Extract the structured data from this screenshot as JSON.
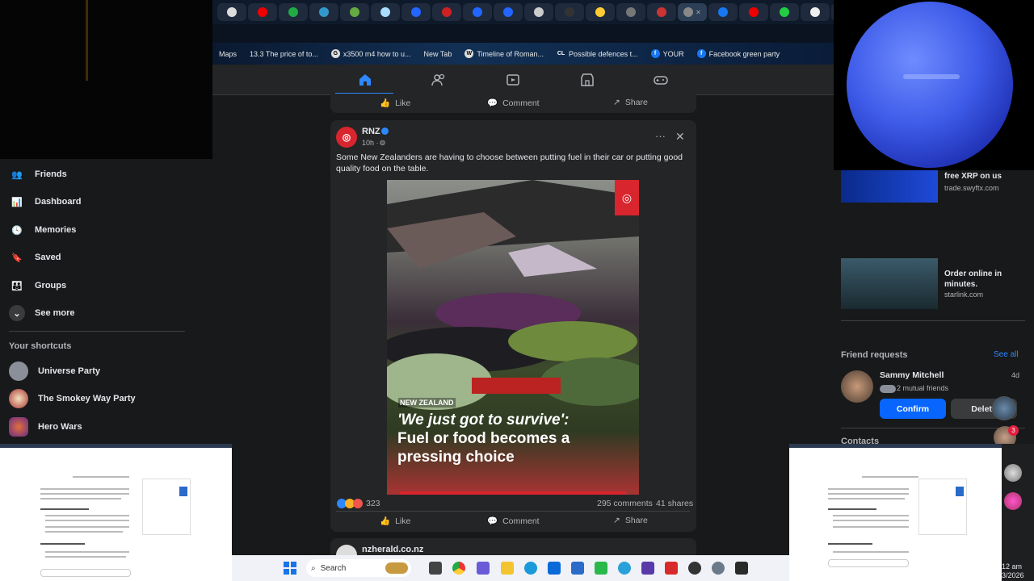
{
  "bookmarks": [
    {
      "label": "Maps",
      "icon": "maps-icon"
    },
    {
      "label": "13.3 The price of to...",
      "icon": "page-icon"
    },
    {
      "label": "x3500 m4 how to u...",
      "icon": "google-icon"
    },
    {
      "label": "New Tab",
      "icon": "new-tab-icon"
    },
    {
      "label": "Timeline of Roman...",
      "icon": "wikipedia-icon"
    },
    {
      "label": "Possible defences t...",
      "icon": "cl-icon"
    },
    {
      "label": "YOUR",
      "icon": "facebook-icon"
    },
    {
      "label": "Facebook green party",
      "icon": "facebook-icon"
    }
  ],
  "left_nav": {
    "items": [
      {
        "label": "Friends",
        "icon": "friends-icon"
      },
      {
        "label": "Dashboard",
        "icon": "dashboard-icon"
      },
      {
        "label": "Memories",
        "icon": "memories-icon"
      },
      {
        "label": "Saved",
        "icon": "saved-icon"
      },
      {
        "label": "Groups",
        "icon": "groups-icon"
      },
      {
        "label": "See more",
        "icon": "chevron-down-icon"
      }
    ],
    "shortcuts_title": "Your shortcuts",
    "shortcuts": [
      {
        "label": "Universe Party"
      },
      {
        "label": "The Smokey Way Party"
      },
      {
        "label": "Hero Wars"
      }
    ]
  },
  "prev_post_actions": {
    "like": "Like",
    "comment": "Comment",
    "share": "Share"
  },
  "post": {
    "author": "RNZ",
    "time": "10h ·",
    "text": "Some New Zealanders are having to choose between putting fuel in their car or putting good quality food on the table.",
    "image_tag": "NEW ZEALAND",
    "image_headline_1": "'We just got to survive':",
    "image_headline_2": "Fuel or food becomes a",
    "image_headline_3": "pressing choice",
    "reactions_count": "323",
    "comments": "295 comments",
    "shares": "41 shares",
    "actions": {
      "like": "Like",
      "comment": "Comment",
      "share": "Share"
    }
  },
  "next_post": {
    "author": "nzherald.co.nz"
  },
  "ads": [
    {
      "title": "free XRP on us",
      "domain": "trade.swyftx.com"
    },
    {
      "title": "Order online in minutes.",
      "domain": "starlink.com"
    }
  ],
  "friend_requests": {
    "title": "Friend requests",
    "see_all": "See all",
    "name": "Sammy Mitchell",
    "age": "4d",
    "mutual": "2 mutual friends",
    "confirm": "Confirm",
    "delete": "Delete"
  },
  "contacts_title": "Contacts",
  "contact_badge": "3",
  "taskbar": {
    "search_placeholder": "Search",
    "time": "12 am",
    "date": "3/2026"
  },
  "colors": {
    "accent": "#0866ff",
    "bg": "#18191a",
    "card": "#242526"
  }
}
